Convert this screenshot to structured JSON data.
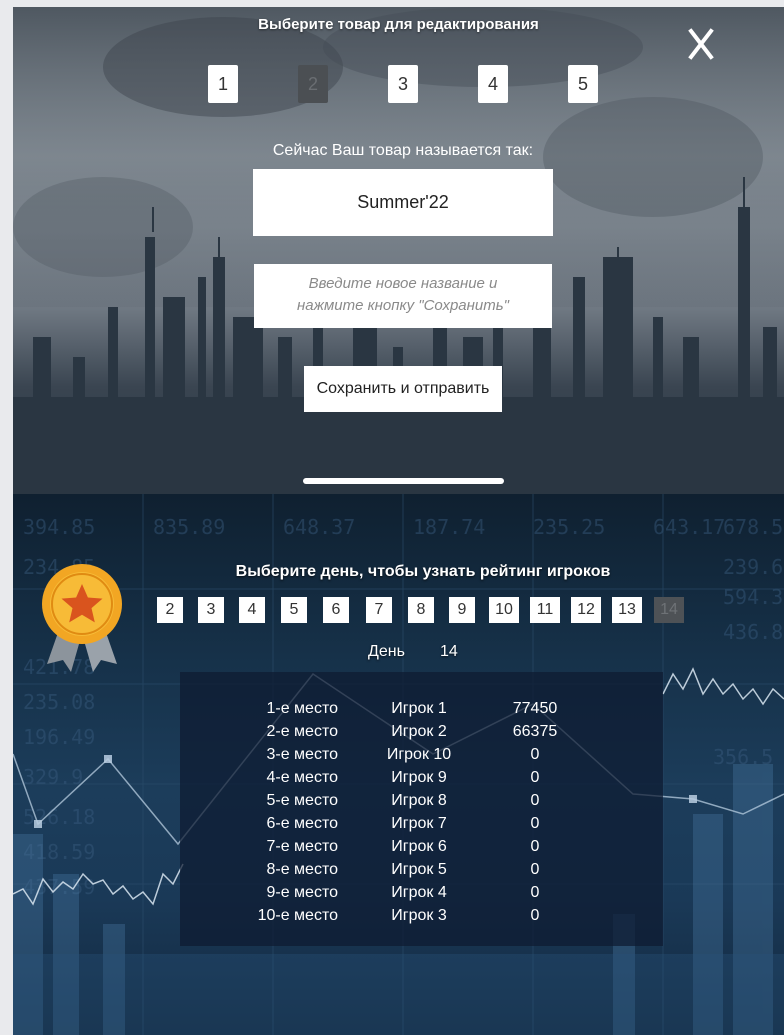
{
  "edit_panel": {
    "title": "Выберите товар для редактирования",
    "close_label": "X",
    "items": [
      "1",
      "2",
      "3",
      "4",
      "5"
    ],
    "selected_item": "2",
    "current_name_label": "Сейчас Ваш товар называется так:",
    "current_name": "Summer'22",
    "new_name_placeholder": "Введите новое название и\nнажмите кнопку \"Сохранить\"",
    "save_button": "Сохранить и отправить"
  },
  "rating_panel": {
    "title": "Выберите день, чтобы узнать рейтинг игроков",
    "days": [
      "2",
      "3",
      "4",
      "5",
      "6",
      "7",
      "8",
      "9",
      "10",
      "11",
      "12",
      "13",
      "14"
    ],
    "selected_day": "14",
    "day_label": "День",
    "day_value": "14",
    "rows": [
      {
        "place": "1-е место",
        "player": "Игрок 1",
        "score": "77450"
      },
      {
        "place": "2-е место",
        "player": "Игрок 2",
        "score": "66375"
      },
      {
        "place": "3-е место",
        "player": "Игрок 10",
        "score": "0"
      },
      {
        "place": "4-е место",
        "player": "Игрок 9",
        "score": "0"
      },
      {
        "place": "5-е место",
        "player": "Игрок 8",
        "score": "0"
      },
      {
        "place": "6-е место",
        "player": "Игрок 7",
        "score": "0"
      },
      {
        "place": "7-е место",
        "player": "Игрок 6",
        "score": "0"
      },
      {
        "place": "8-е место",
        "player": "Игрок 5",
        "score": "0"
      },
      {
        "place": "9-е место",
        "player": "Игрок 4",
        "score": "0"
      },
      {
        "place": "10-е место",
        "player": "Игрок 3",
        "score": "0"
      }
    ]
  },
  "colors": {
    "button_bg": "#ffffff",
    "selected_bg": "#4b4f53",
    "text_light": "#ffffff",
    "medal_gold": "#f2a623",
    "ribbon": "#8c949c"
  },
  "icons": {
    "close": "close-icon",
    "medal": "medal-icon",
    "star": "star-icon"
  }
}
